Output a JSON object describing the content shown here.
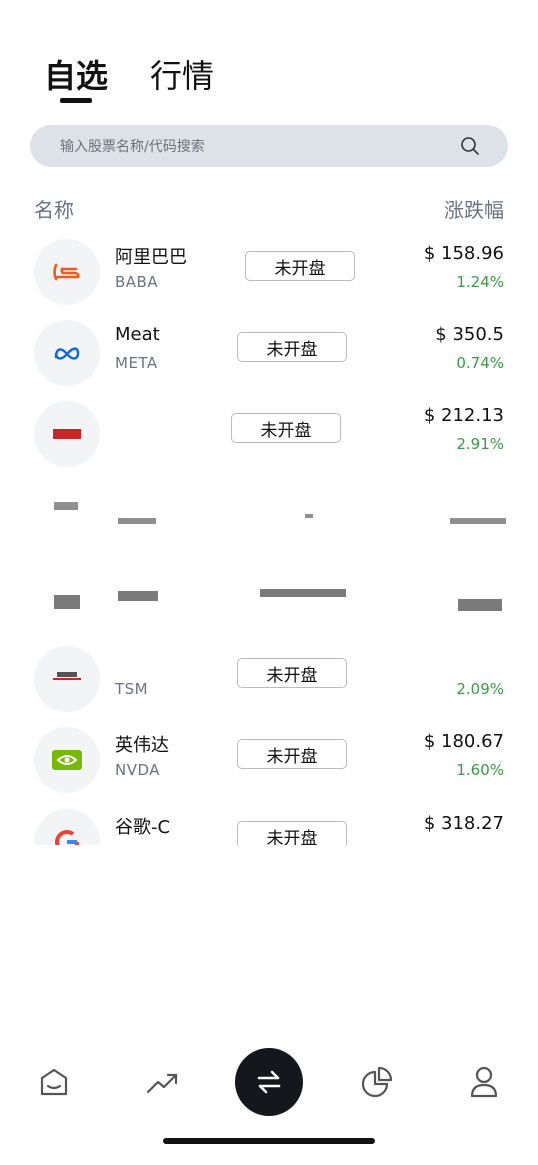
{
  "tabs": [
    {
      "label": "自选",
      "active": true
    },
    {
      "label": "行情",
      "active": false
    }
  ],
  "search": {
    "placeholder": "输入股票名称/代码搜索"
  },
  "list_header": {
    "name": "名称",
    "change": "涨跌幅"
  },
  "stocks": [
    {
      "name": "阿里巴巴",
      "code": "BABA",
      "status": "未开盘",
      "price": "$ 158.96",
      "change": "1.24%",
      "logo": "alibaba-icon"
    },
    {
      "name": "Meat",
      "code": "META",
      "status": "未开盘",
      "price": "$ 350.5",
      "change": "0.74%",
      "logo": "meta-icon"
    },
    {
      "name": "",
      "code": "",
      "status": "未开盘",
      "price": "$ 212.13",
      "change": "2.91%",
      "logo": "stock-icon"
    },
    {
      "name": "",
      "code": "TSM",
      "status": "未开盘",
      "price": "",
      "change": "2.09%",
      "logo": "tsm-icon"
    },
    {
      "name": "英伟达",
      "code": "NVDA",
      "status": "未开盘",
      "price": "$ 180.67",
      "change": "1.60%",
      "logo": "nvidia-icon"
    },
    {
      "name": "谷歌-C",
      "code": "",
      "status": "未开盘",
      "price": "$ 318.27",
      "change": "",
      "logo": "google-icon"
    }
  ],
  "nav": [
    "home-icon",
    "market-trend-icon",
    "trade-swap-icon",
    "portfolio-pie-icon",
    "profile-icon"
  ],
  "colors": {
    "positive": "#3a9a45",
    "search_bg": "#dde1e8",
    "nav_center_bg": "#16171c"
  }
}
